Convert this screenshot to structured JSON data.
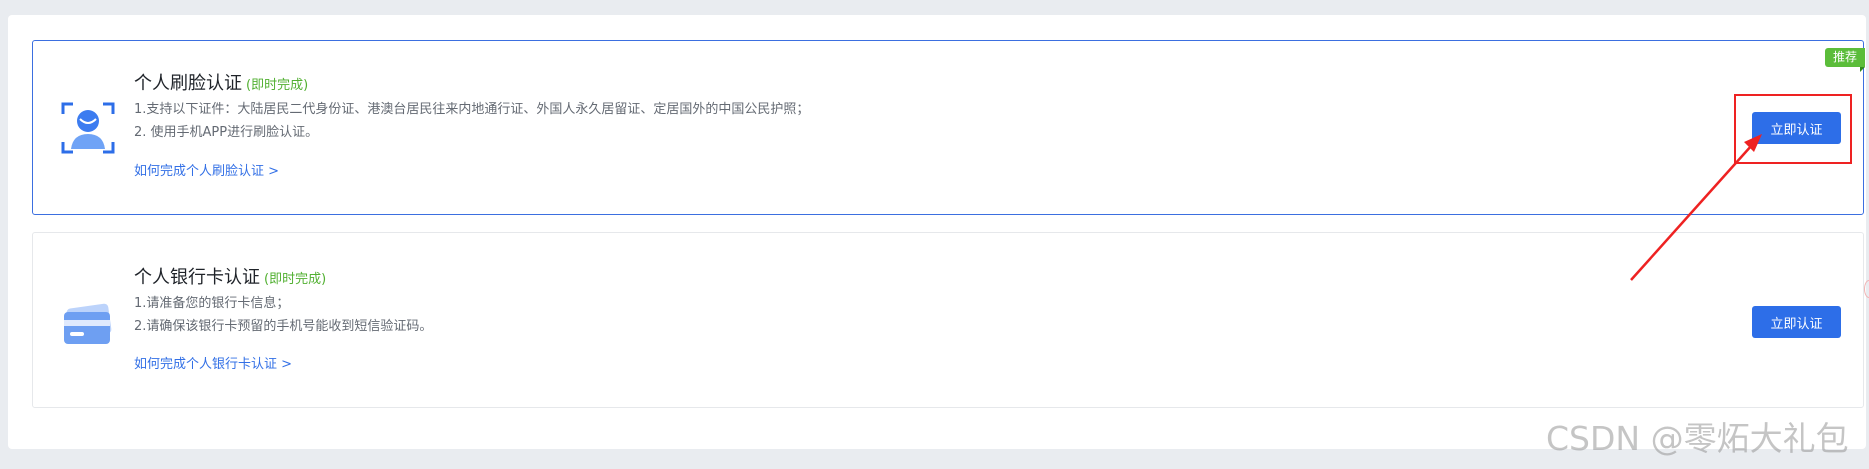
{
  "cards": [
    {
      "title": "个人刷脸认证",
      "tag": "(即时完成)",
      "lines": [
        "1.支持以下证件：大陆居民二代身份证、港澳台居民往来内地通行证、外国人永久居留证、定居国外的中国公民护照；",
        "2. 使用手机APP进行刷脸认证。"
      ],
      "link": "如何完成个人刷脸认证 >",
      "button": "立即认证",
      "badge": "推荐",
      "icon": "face-scan-icon",
      "selected": true
    },
    {
      "title": "个人银行卡认证",
      "tag": "(即时完成)",
      "lines": [
        "1.请准备您的银行卡信息；",
        "2.请确保该银行卡预留的手机号能收到短信验证码。"
      ],
      "link": "如何完成个人银行卡认证 >",
      "button": "立即认证",
      "icon": "bank-card-icon",
      "selected": false
    }
  ],
  "colors": {
    "primary": "#2d6ee8",
    "success": "#52b032",
    "badge": "#5bbd3a",
    "annotation": "#ee2222"
  },
  "watermark": "CSDN @零炻大礼包"
}
